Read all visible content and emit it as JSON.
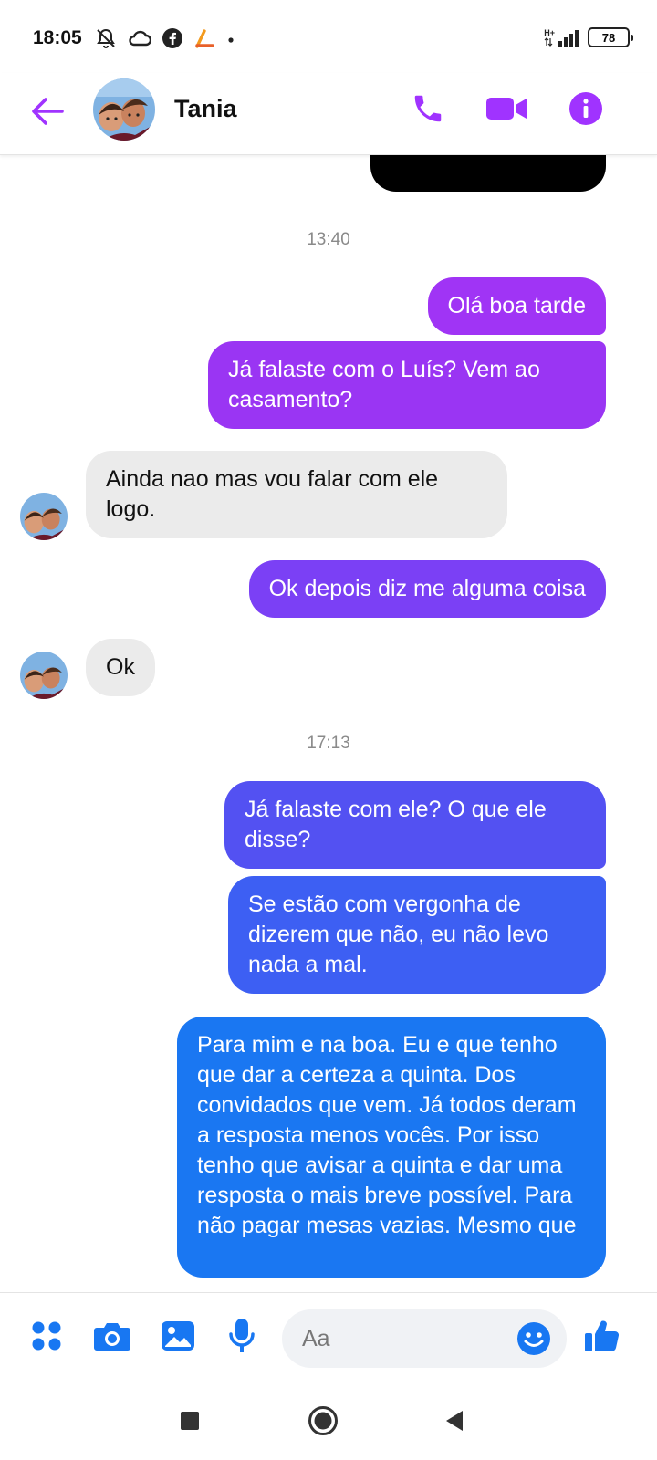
{
  "status_bar": {
    "time": "18:05",
    "battery": "78",
    "network": "H+",
    "icons": [
      "bell-off-icon",
      "cloud-icon",
      "facebook-icon",
      "app-logo-icon",
      "dot-icon",
      "signal-icon",
      "battery-icon"
    ]
  },
  "header": {
    "contact_name": "Tania",
    "back_icon": "arrow-left-icon",
    "call_icon": "phone-icon",
    "video_icon": "video-camera-icon",
    "info_icon": "info-icon",
    "accent_color": "#a033ff"
  },
  "conversation": {
    "timestamp_1": "13:40",
    "timestamp_2": "17:13",
    "msg_1": "Olá boa tarde",
    "msg_2": "Já falaste com o Luís? Vem ao casamento?",
    "msg_3": "Ainda nao mas vou falar com ele logo.",
    "msg_4": "Ok depois diz me alguma coisa",
    "msg_5": "Ok",
    "msg_6": "Já falaste com ele? O que ele disse?",
    "msg_7": "Se estão com vergonha de dizerem que não, eu não levo nada a mal.",
    "msg_8": "Para mim e na boa. Eu e que tenho que dar a certeza a quinta. Dos convidados que vem. Já todos deram a resposta menos vocês. Por isso tenho que avisar a quinta e dar uma resposta o mais breve possível. Para não pagar mesas vazias. Mesmo que",
    "bubble_colors": [
      "#000000",
      "#a034f5",
      "#9a35f3",
      "#7b40f5",
      "#5351f2",
      "#3d5ff3",
      "#1a77f2"
    ],
    "incoming_color": "#ebebeb"
  },
  "composer": {
    "placeholder": "Aa",
    "icons": [
      "apps-grid-icon",
      "camera-icon",
      "image-icon",
      "microphone-icon",
      "emoji-icon",
      "thumbs-up-icon"
    ],
    "accent_color": "#1877f2"
  },
  "nav_bar": {
    "icons": [
      "recents-square-icon",
      "home-circle-icon",
      "back-triangle-icon"
    ]
  }
}
